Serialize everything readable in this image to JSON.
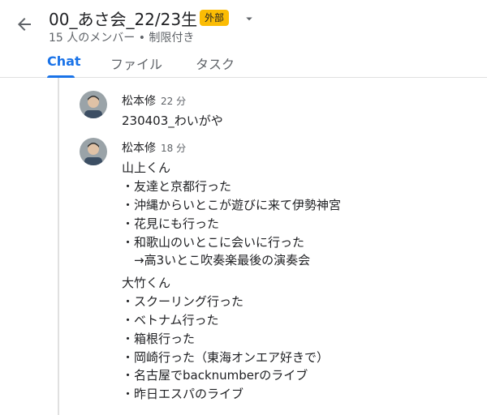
{
  "header": {
    "title": "00_あさ会_22/23生",
    "badge": "外部",
    "subtitle": "15 人のメンバー • 制限付き",
    "tabs": [
      {
        "label": "Chat",
        "active": true
      },
      {
        "label": "ファイル",
        "active": false
      },
      {
        "label": "タスク",
        "active": false
      }
    ]
  },
  "colors": {
    "accent": "#1a73e8",
    "badge": "#fbbc04"
  },
  "messages": [
    {
      "sender": "松本修",
      "time": "22 分",
      "lines": [
        "230403_わいがや"
      ]
    },
    {
      "sender": "松本修",
      "time": "18 分",
      "lines": [
        "山上くん",
        "・友達と京都行った",
        "・沖縄からいとこが遊びに来て伊勢神宮",
        "・花見にも行った",
        "・和歌山のいとこに会いに行った",
        "　→高3いとこ吹奏楽最後の演奏会",
        "大竹くん",
        "・スクーリング行った",
        "・ベトナム行った",
        "・箱根行った",
        "・岡崎行った（東海オンエア好きで）",
        "・名古屋でbacknumberのライブ",
        "・昨日エスパのライブ"
      ]
    }
  ]
}
